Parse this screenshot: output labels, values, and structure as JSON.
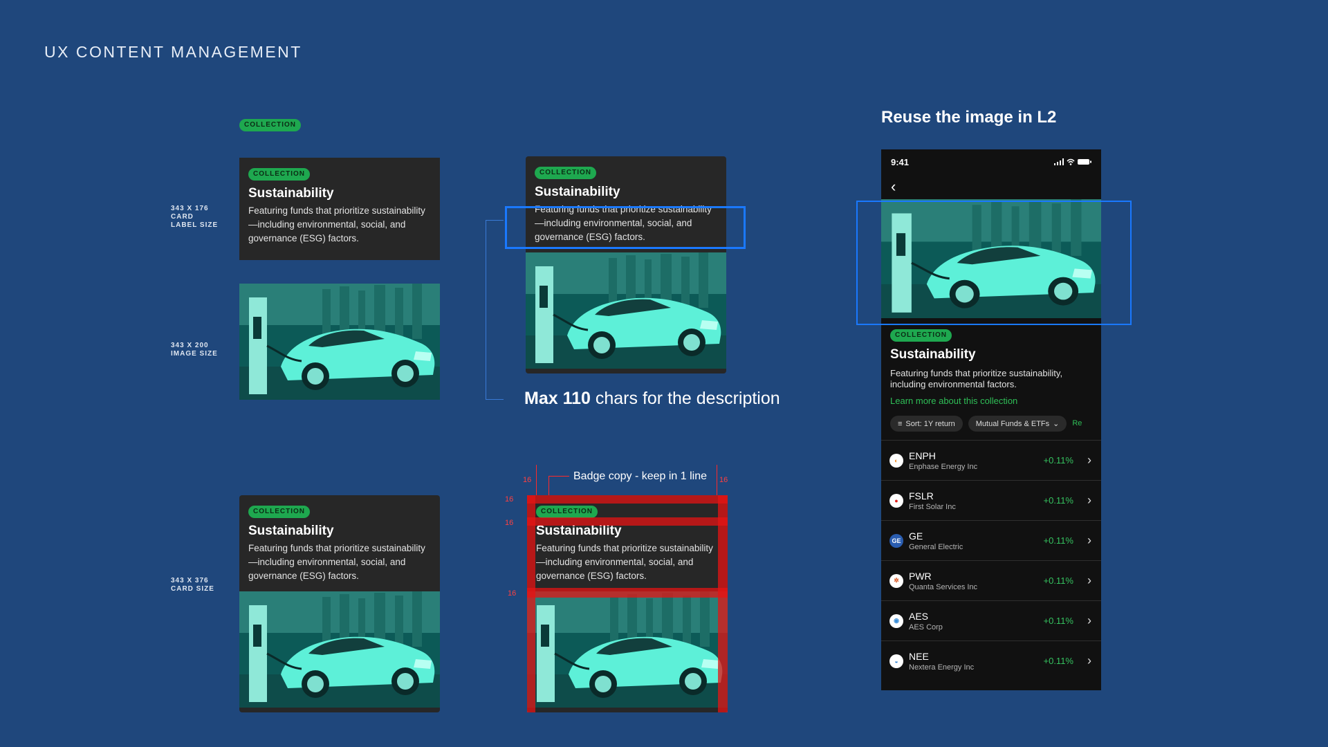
{
  "page_title": "UX CONTENT MANAGEMENT",
  "badge_text": "COLLECTION",
  "card": {
    "title": "Sustainability",
    "description": "Featuring funds that prioritize sustainability—including environmental, social, and governance (ESG) factors."
  },
  "specs": {
    "label_size": "343 X 176\nCARD\nLABEL SIZE",
    "image_size": "343 X 200\nIMAGE SIZE",
    "card_size": "343 X 376\nCARD SIZE"
  },
  "max_note": {
    "bold": "Max 110",
    "rest": " chars for the description"
  },
  "badge_note": "Badge copy - keep in 1 line",
  "red_marks": {
    "top_left": "16",
    "top_right": "16",
    "left_a": "16",
    "left_b": "16",
    "left_c": "16"
  },
  "reuse_heading": "Reuse the image in L2",
  "phone": {
    "time": "9:41",
    "back_icon": "chevron-left",
    "title": "Sustainability",
    "description": "Featuring funds that prioritize sustainability, including environmental factors.",
    "learn_more": "Learn more about this collection",
    "chips": [
      "Sort: 1Y return",
      "Mutual Funds & ETFs"
    ],
    "chip_more": "Re",
    "rows": [
      {
        "ticker": "ENPH",
        "company": "Enphase Energy Inc",
        "change": "+0.11%",
        "logo_color": "#f08a24"
      },
      {
        "ticker": "FSLR",
        "company": "First Solar Inc",
        "change": "+0.11%",
        "logo_color": "#e0201b"
      },
      {
        "ticker": "GE",
        "company": "General Electric",
        "change": "+0.11%",
        "logo_color": "#2a5db0"
      },
      {
        "ticker": "PWR",
        "company": "Quanta Services Inc",
        "change": "+0.11%",
        "logo_color": "#d9531e"
      },
      {
        "ticker": "AES",
        "company": "AES Corp",
        "change": "+0.11%",
        "logo_color": "#3a8ed8"
      },
      {
        "ticker": "NEE",
        "company": "Nextera Energy Inc",
        "change": "+0.11%",
        "logo_color": "#2a7fd0"
      }
    ]
  },
  "colors": {
    "background": "#1f477c",
    "card": "#272727",
    "badge": "#1ea84f",
    "accent_green": "#35c25f",
    "highlight_blue": "#1a79ff",
    "spacing_red": "#e61414"
  }
}
